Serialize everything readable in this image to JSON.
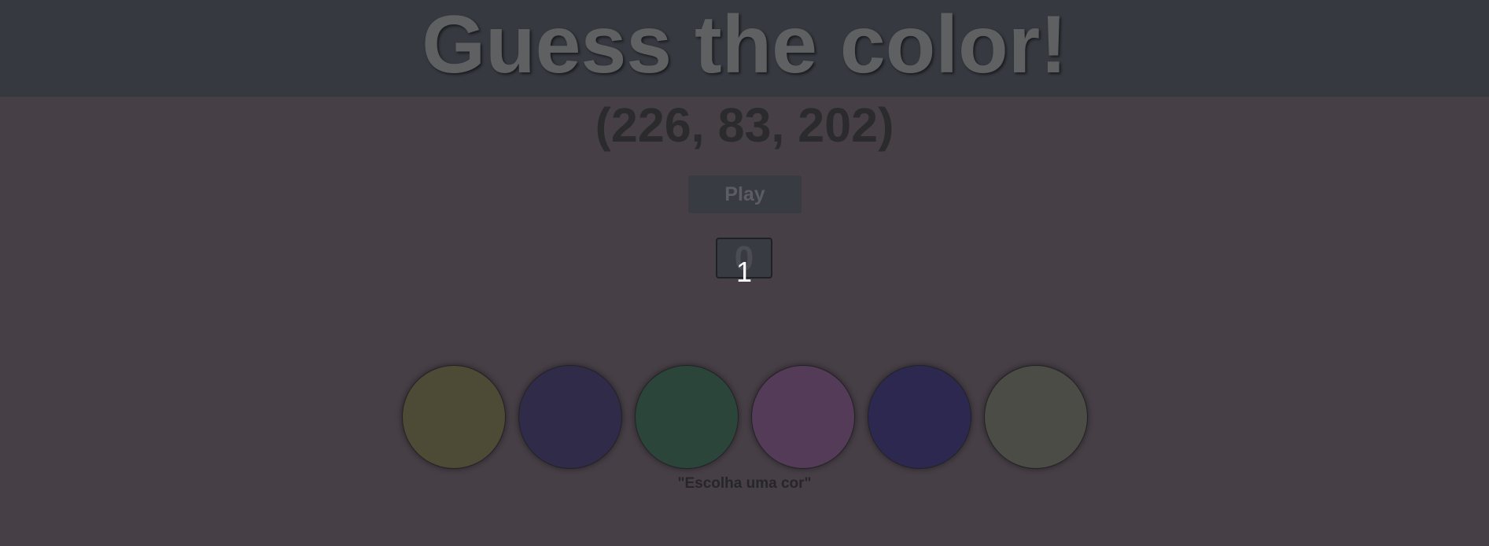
{
  "header": {
    "title": "Guess the color!"
  },
  "target": {
    "rgb_text": "(226, 83, 202)"
  },
  "controls": {
    "play_label": "Play"
  },
  "score": {
    "value": "0",
    "overlay_number": "1"
  },
  "circles": [
    {
      "color": "#4d4a36"
    },
    {
      "color": "#2f2b48"
    },
    {
      "color": "#2c453a"
    },
    {
      "color": "#543b58"
    },
    {
      "color": "#2c2850"
    },
    {
      "color": "#4b4c45"
    }
  ],
  "message": "\"Escolha uma cor\"",
  "colors": {
    "page_background": "#463f46",
    "header_background": "#363940"
  }
}
